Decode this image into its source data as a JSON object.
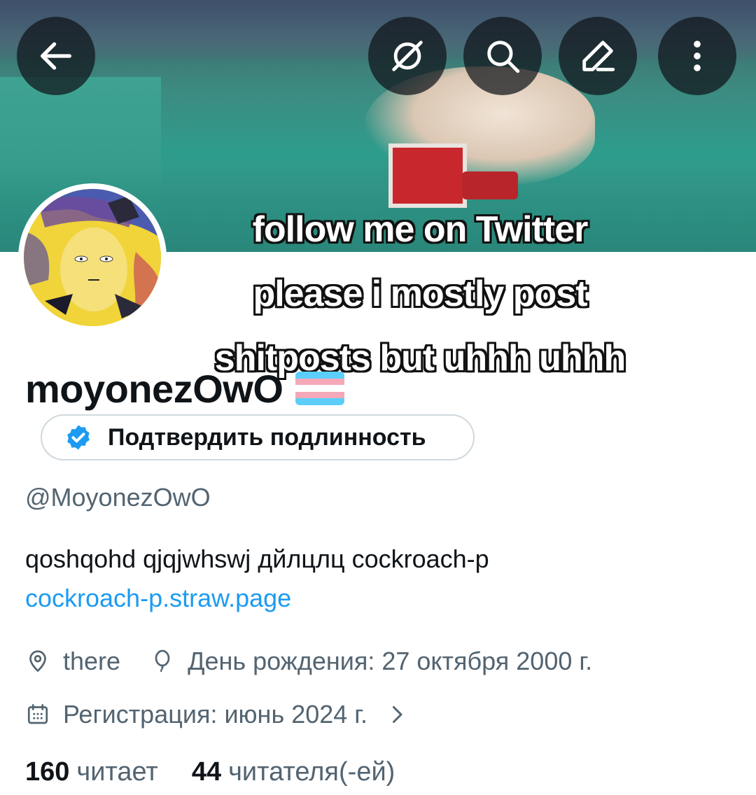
{
  "banner": {
    "caption_lines": [
      "follow me on  Twitter",
      "please i mostly post",
      "shitposts but uhhh uhhh"
    ]
  },
  "nav": {
    "back_icon": "arrow-left-icon",
    "grok_icon": "slashed-circle-icon",
    "search_icon": "search-icon",
    "edit_icon": "pencil-icon",
    "more_icon": "more-vertical-icon"
  },
  "profile": {
    "display_name": "moyonezOwO",
    "flag": "trans-flag",
    "verify_label": "Подтвердить подлинность",
    "handle": "@MoyonezOwO",
    "bio": "qoshqohd qjqjwhswj дйлцлц cockroach-p",
    "link": "cockroach-p.straw.page",
    "location": "there",
    "birthday": "День рождения: 27 октября 2000 г.",
    "joined": "Регистрация: июнь 2024 г.",
    "following_count": "160",
    "following_label": "читает",
    "followers_count": "44",
    "followers_label": "читателя(-ей)"
  },
  "colors": {
    "accent": "#1d9bf0",
    "text": "#0f1419",
    "secondary": "#536471",
    "flag_blue": "#5bcefa",
    "flag_pink": "#f5a9b8",
    "flag_white": "#ffffff"
  }
}
